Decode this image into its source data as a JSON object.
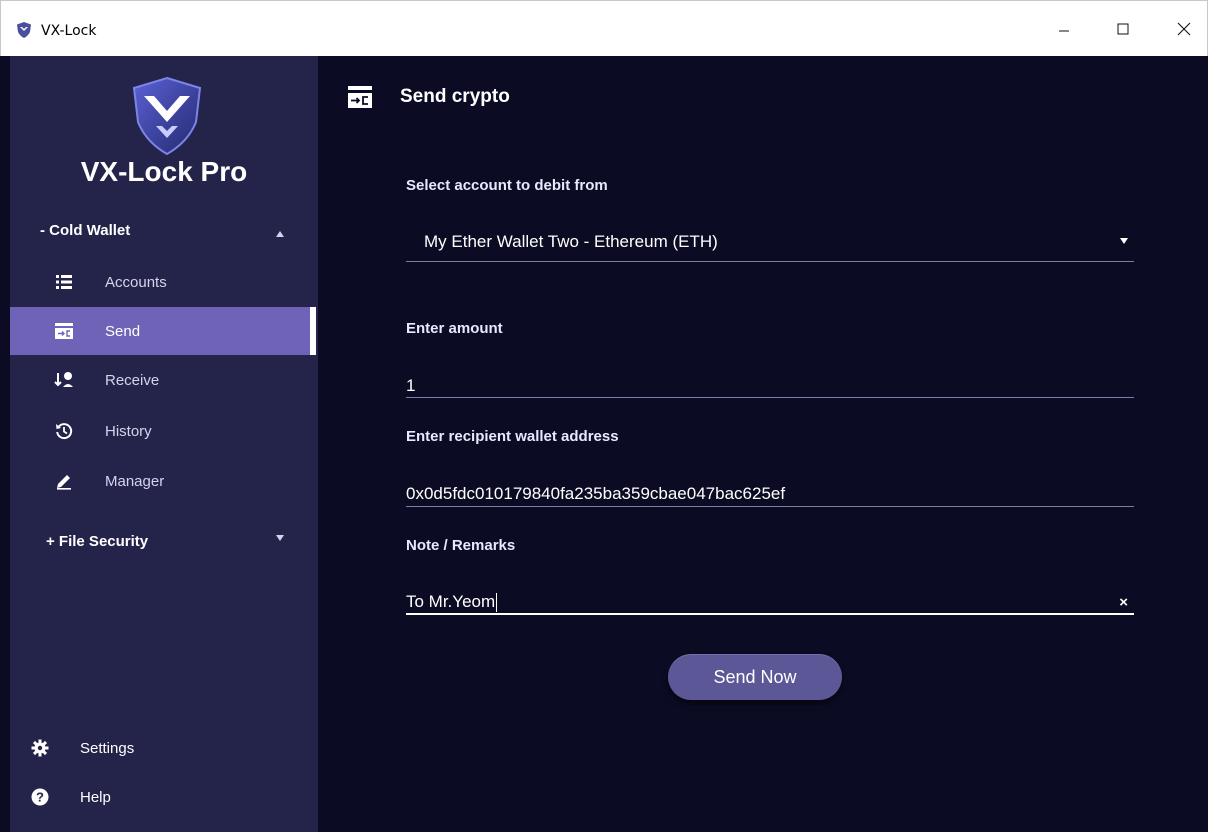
{
  "window": {
    "title": "VX-Lock"
  },
  "sidebar": {
    "brand": "VX-Lock Pro",
    "groups": {
      "cold_wallet": "- Cold Wallet",
      "file_security": "+ File Security"
    },
    "items": [
      {
        "label": "Accounts",
        "icon": "list-icon"
      },
      {
        "label": "Send",
        "icon": "send-icon",
        "active": true
      },
      {
        "label": "Receive",
        "icon": "receive-icon"
      },
      {
        "label": "History",
        "icon": "history-icon"
      },
      {
        "label": "Manager",
        "icon": "pencil-icon"
      }
    ],
    "bottom": [
      {
        "label": "Settings",
        "icon": "gear-icon"
      },
      {
        "label": "Help",
        "icon": "help-icon"
      }
    ]
  },
  "main": {
    "title": "Send crypto",
    "account_label": "Select account to debit from",
    "account_value": "My Ether Wallet Two - Ethereum (ETH)",
    "amount_label": "Enter amount",
    "amount_value": "1",
    "address_label": "Enter recipient wallet address",
    "address_value": "0x0d5fdc010179840fa235ba359cbae047bac625ef",
    "note_label": "Note / Remarks",
    "note_value": "To Mr.Yeom",
    "clear_symbol": "×",
    "send_button": "Send Now"
  },
  "colors": {
    "background": "#0b0b24",
    "sidebar": "#24234a",
    "active_item": "#6e63b6",
    "button": "#5c5796"
  }
}
